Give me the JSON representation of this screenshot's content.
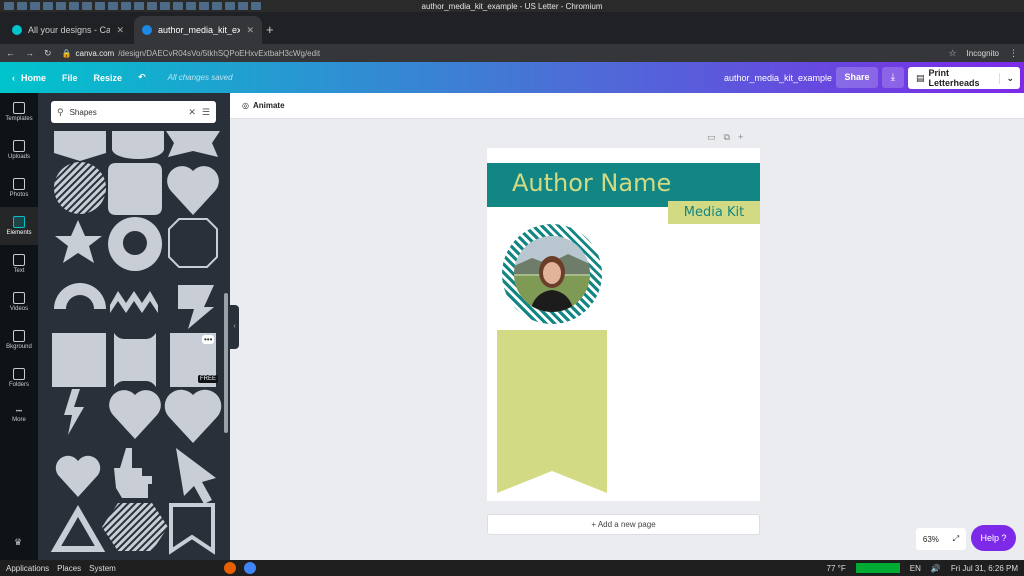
{
  "os_top": {
    "window_title": "author_media_kit_example - US Letter - Chromium"
  },
  "tabs": [
    {
      "label": "All your designs - Canva"
    },
    {
      "label": "author_media_kit_examp"
    }
  ],
  "address": {
    "host": "canva.com",
    "path": "/design/DAECvR04sVo/5tkhSQPoEHxvExtbaH3cWg/edit",
    "incognito": "Incognito"
  },
  "header": {
    "home": "Home",
    "file": "File",
    "resize": "Resize",
    "saved": "All changes saved",
    "doc_name": "author_media_kit_example",
    "share": "Share",
    "print": "Print Letterheads"
  },
  "rail": [
    {
      "label": "Templates"
    },
    {
      "label": "Uploads"
    },
    {
      "label": "Photos"
    },
    {
      "label": "Elements"
    },
    {
      "label": "Text"
    },
    {
      "label": "Videos"
    },
    {
      "label": "Bkground"
    },
    {
      "label": "Folders"
    },
    {
      "label": "More"
    }
  ],
  "panel": {
    "search_value": "Shapes",
    "free_badge": "FREE"
  },
  "toolbar": {
    "animate": "Animate"
  },
  "design": {
    "author": "Author Name",
    "media_kit": "Media Kit"
  },
  "add_page": "+ Add a new page",
  "zoom": "63%",
  "help": "Help ?",
  "os_bottom": {
    "menu": [
      "Applications",
      "Places",
      "System"
    ],
    "weather": "77 °F",
    "lang": "EN",
    "clock": "Fri Jul 31,  6:26 PM"
  },
  "colors": {
    "teal": "#128684",
    "lime": "#d3da84",
    "purple": "#7d2ae8"
  }
}
